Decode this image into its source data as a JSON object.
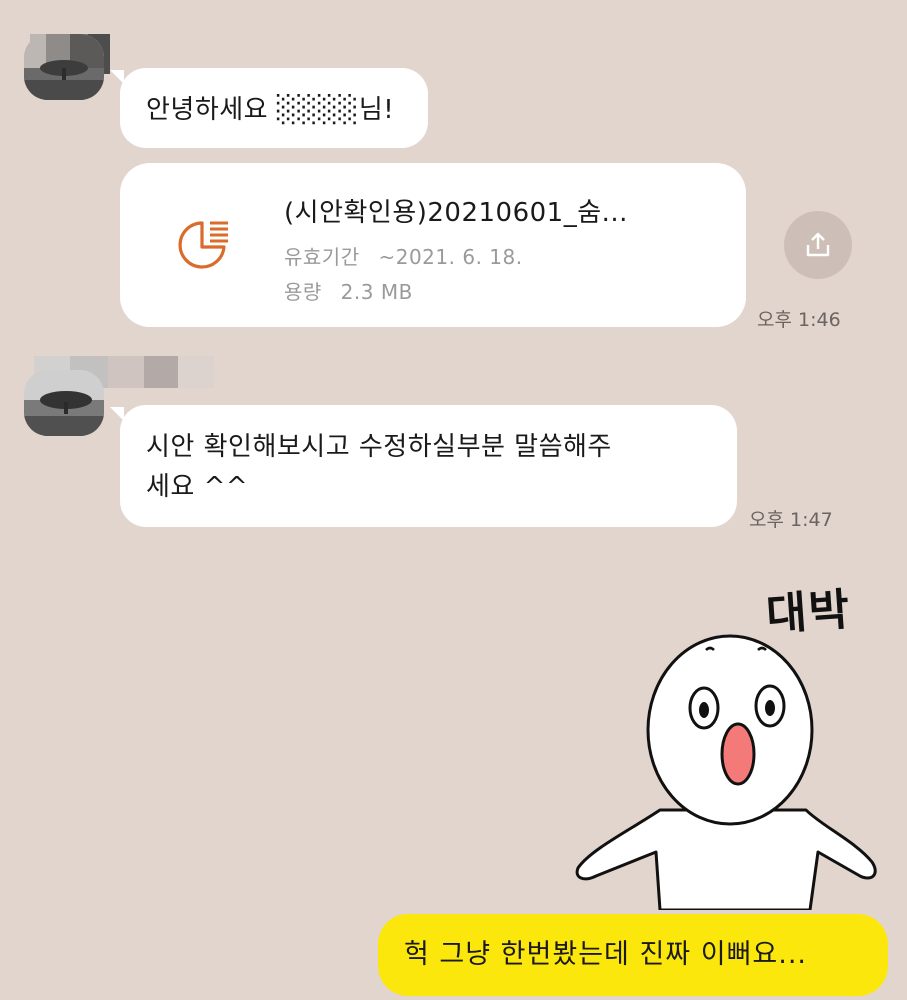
{
  "messages": [
    {
      "text": "안녕하세요 ░░░░님!"
    },
    {
      "file": {
        "name": "(시안확인용)20210601_숨...",
        "expiry_label": "유효기간",
        "expiry_value": "~2021. 6. 18.",
        "size_label": "용량",
        "size_value": "2.3 MB"
      },
      "time": "오후 1:46"
    },
    {
      "text_line1": "시안 확인해보시고 수정하실부분 말씀해주",
      "text_line2": "세요 ^^",
      "time": "오후 1:47"
    }
  ],
  "sticker": {
    "caption": "대박"
  },
  "my_message": {
    "text": "헉 그냥 한번봤는데 진짜 이뻐요..."
  },
  "colors": {
    "background": "#e2d5ce",
    "bubble_incoming": "#ffffff",
    "bubble_outgoing": "#fce70c",
    "file_icon": "#d96b2b"
  },
  "icons": {
    "file": "pie-chart-document-icon",
    "share": "share-upload-icon"
  }
}
